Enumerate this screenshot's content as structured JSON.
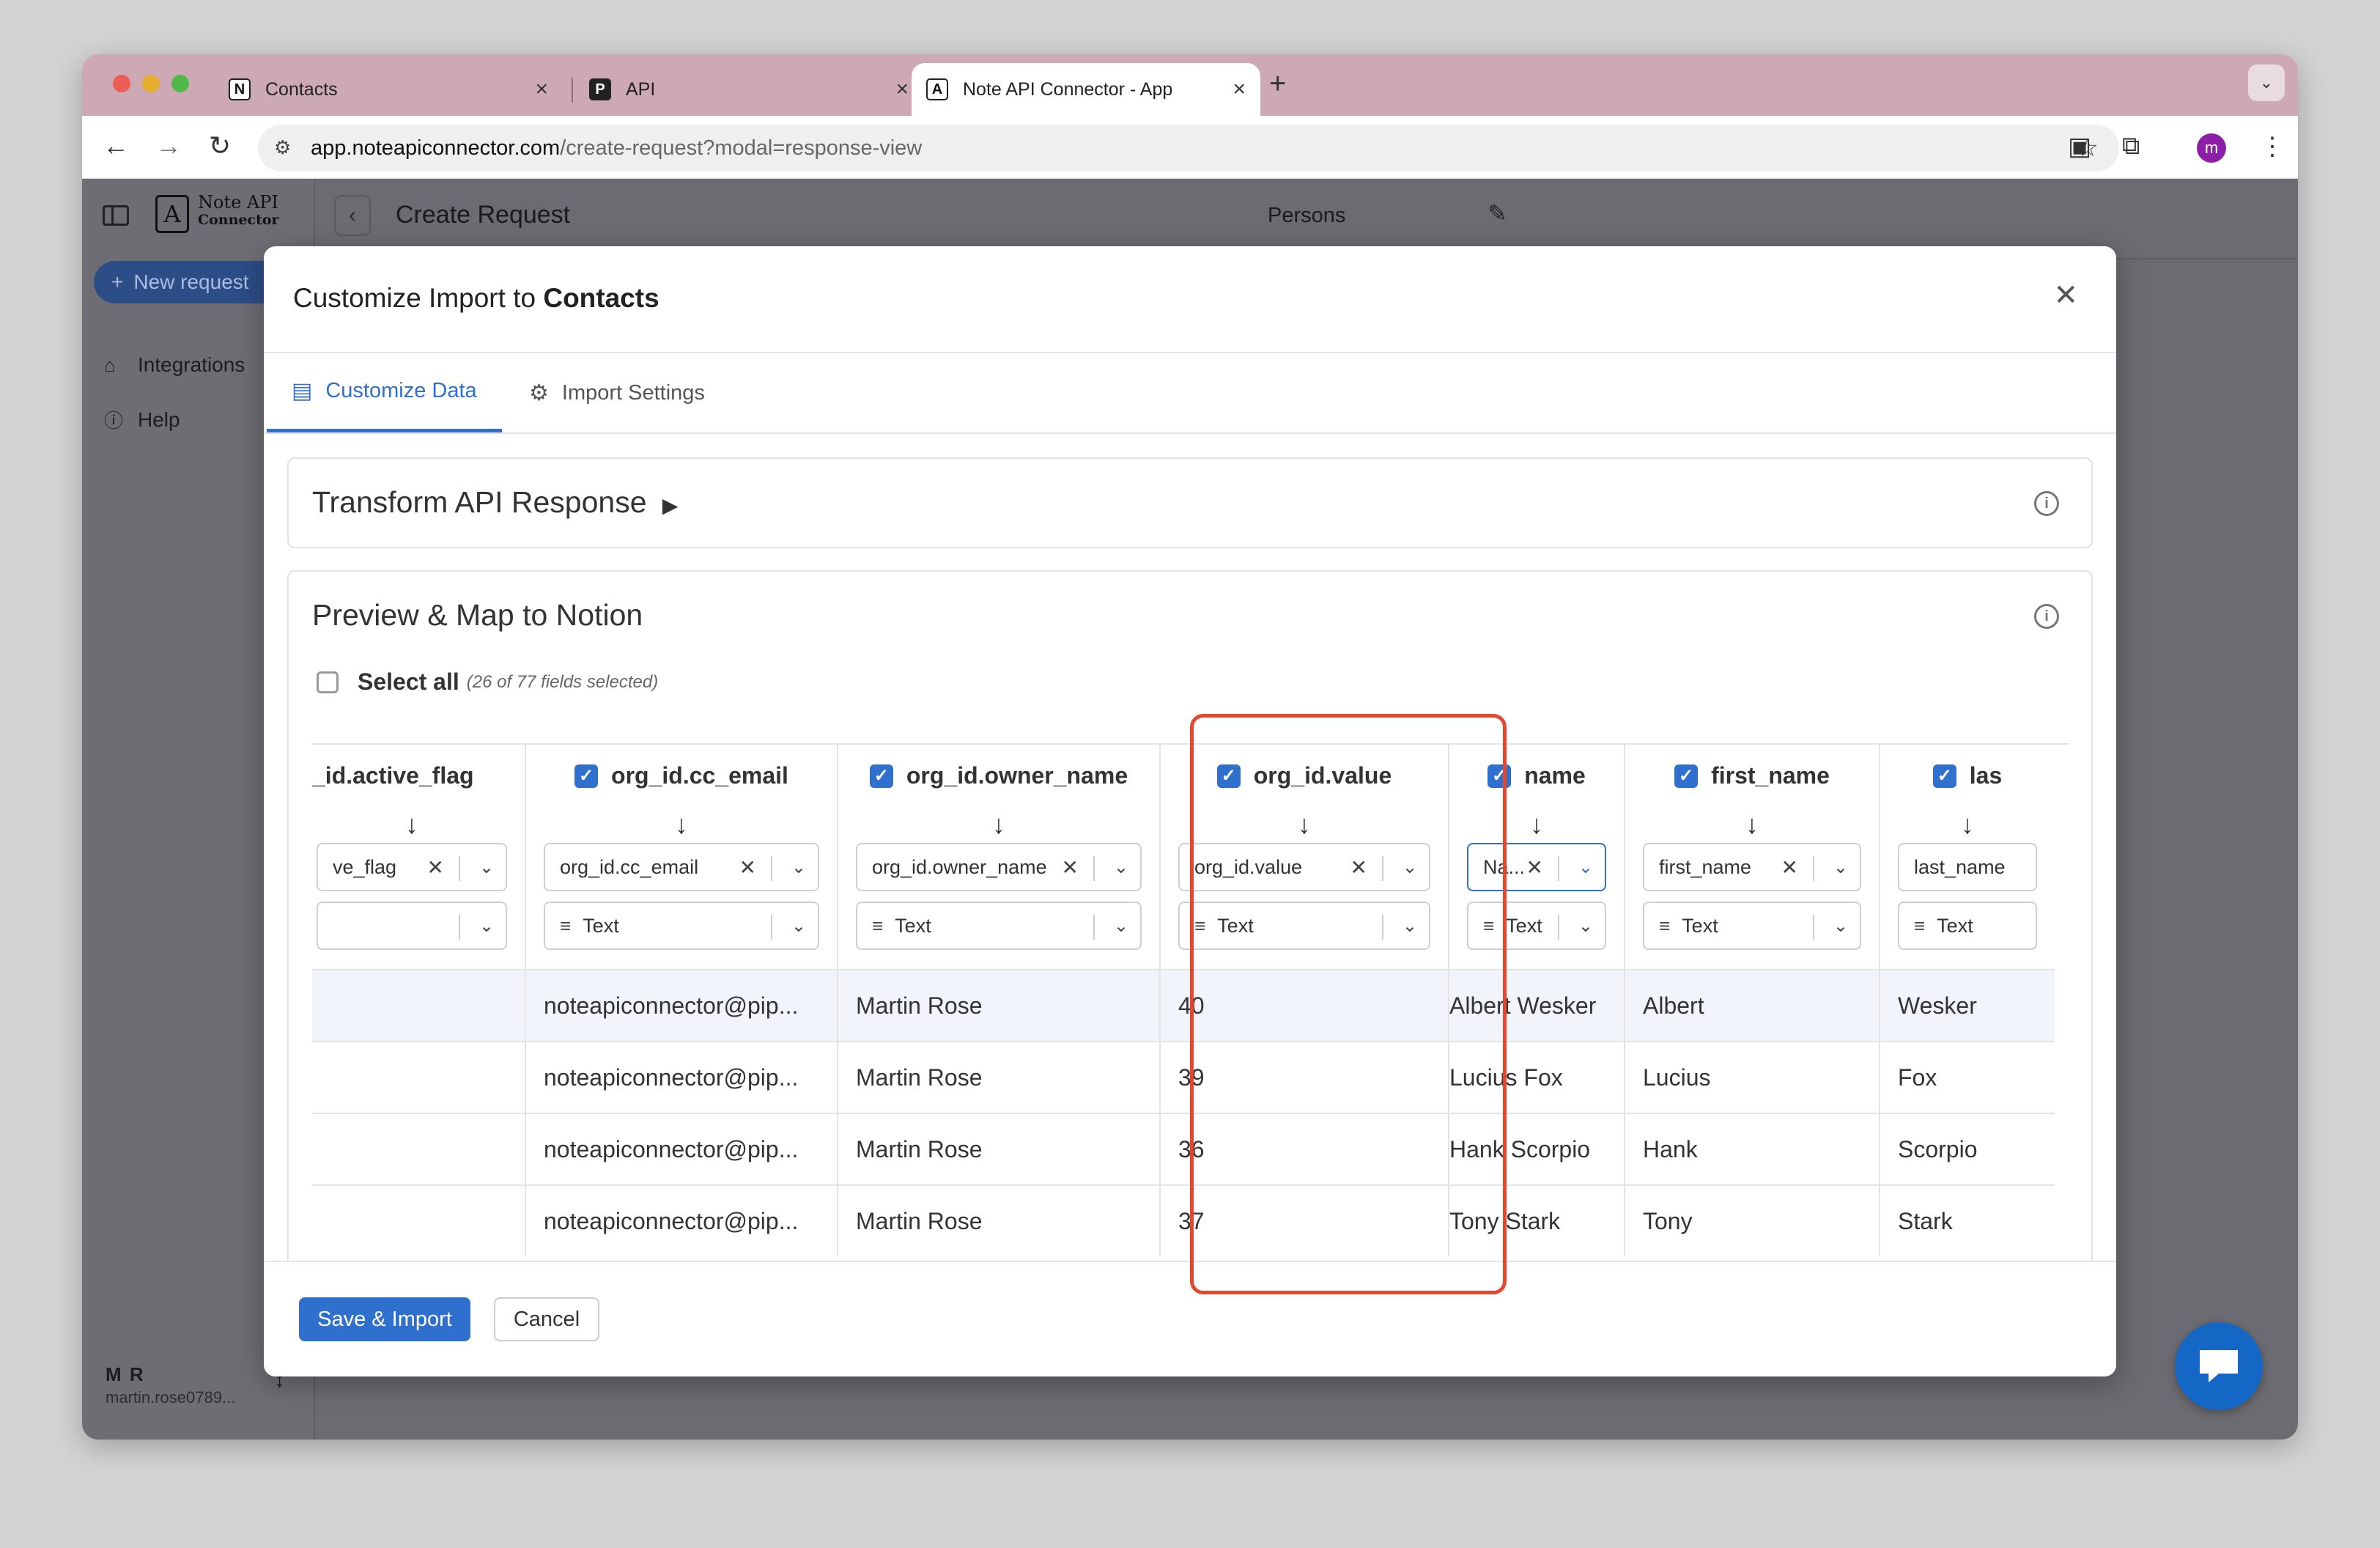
{
  "browser": {
    "tabs": [
      {
        "title": "Contacts",
        "favicon": "N"
      },
      {
        "title": "API",
        "favicon": "P"
      },
      {
        "title": "Note API Connector - App",
        "favicon": "A"
      }
    ],
    "url_host": "app.noteapiconnector.com",
    "url_path": "/create-request?modal=response-view",
    "profile_initial": "m"
  },
  "app": {
    "logo_line1": "Note API",
    "logo_line2": "Connector",
    "new_request": "New request",
    "nav": [
      {
        "label": "Integrations",
        "icon": "graduation-cap-icon"
      },
      {
        "label": "Help",
        "icon": "help-circle-icon"
      }
    ],
    "user_initials": "M R",
    "user_email": "martin.rose0789...",
    "page_title": "Create Request",
    "request_name": "Persons"
  },
  "modal": {
    "title_prefix": "Customize Import to",
    "title_target": "Contacts",
    "tabs": [
      "Customize Data",
      "Import Settings"
    ],
    "transform_title": "Transform API Response",
    "preview_title": "Preview & Map to Notion",
    "select_all_label": "Select all",
    "select_all_count": "(26 of 77 fields selected)",
    "save_button": "Save & Import",
    "cancel_button": "Cancel"
  },
  "columns": [
    {
      "label": "_id.active_flag",
      "checked": false,
      "mapping": "ve_flag",
      "type": "",
      "cells": [
        "",
        "",
        "",
        ""
      ]
    },
    {
      "label": "org_id.cc_email",
      "checked": true,
      "mapping": "org_id.cc_email",
      "type": "Text",
      "cells": [
        "noteapiconnector@pip...",
        "noteapiconnector@pip...",
        "noteapiconnector@pip...",
        "noteapiconnector@pip..."
      ]
    },
    {
      "label": "org_id.owner_name",
      "checked": true,
      "mapping": "org_id.owner_name",
      "type": "Text",
      "cells": [
        "Martin Rose",
        "Martin Rose",
        "Martin Rose",
        "Martin Rose"
      ]
    },
    {
      "label": "org_id.value",
      "checked": true,
      "mapping": "org_id.value",
      "type": "Text",
      "cells": [
        "40",
        "39",
        "36",
        "37"
      ]
    },
    {
      "label": "name",
      "checked": true,
      "mapping": "Na...",
      "type": "Text",
      "cells": [
        "Albert Wesker",
        "Lucius Fox",
        "Hank Scorpio",
        "Tony Stark"
      ]
    },
    {
      "label": "first_name",
      "checked": true,
      "mapping": "first_name",
      "type": "Text",
      "cells": [
        "Albert",
        "Lucius",
        "Hank",
        "Tony"
      ]
    },
    {
      "label": "las",
      "checked": true,
      "mapping": "last_name",
      "type": "Text",
      "cells": [
        "Wesker",
        "Fox",
        "Scorpio",
        "Stark"
      ]
    }
  ],
  "colors": {
    "accent": "#2f6fce",
    "highlight": "#e4472d",
    "tabstrip": "#cda9b6"
  }
}
